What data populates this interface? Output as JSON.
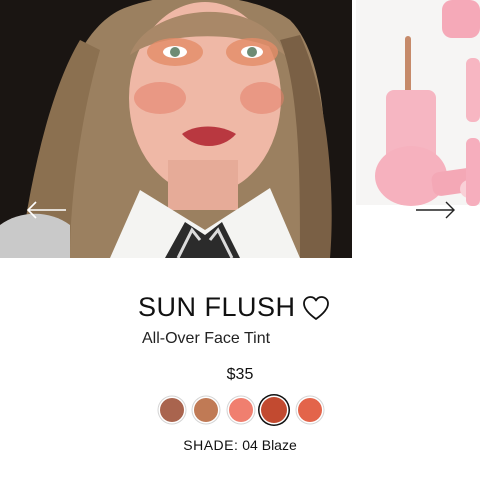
{
  "product": {
    "title": "SUN FLUSH",
    "subtitle": "All-Over Face Tint",
    "price": "$35"
  },
  "icons": {
    "favorite": "heart-outline-icon",
    "prev": "arrow-left-icon",
    "next": "arrow-right-icon"
  },
  "swatches": [
    {
      "color": "#a9644e",
      "selected": false
    },
    {
      "color": "#c07a55",
      "selected": false
    },
    {
      "color": "#f07f6f",
      "selected": false
    },
    {
      "color": "#c24a30",
      "selected": true
    },
    {
      "color": "#e3644a",
      "selected": false
    }
  ],
  "shade": {
    "label": "SHADE:",
    "value": "04 Blaze"
  }
}
